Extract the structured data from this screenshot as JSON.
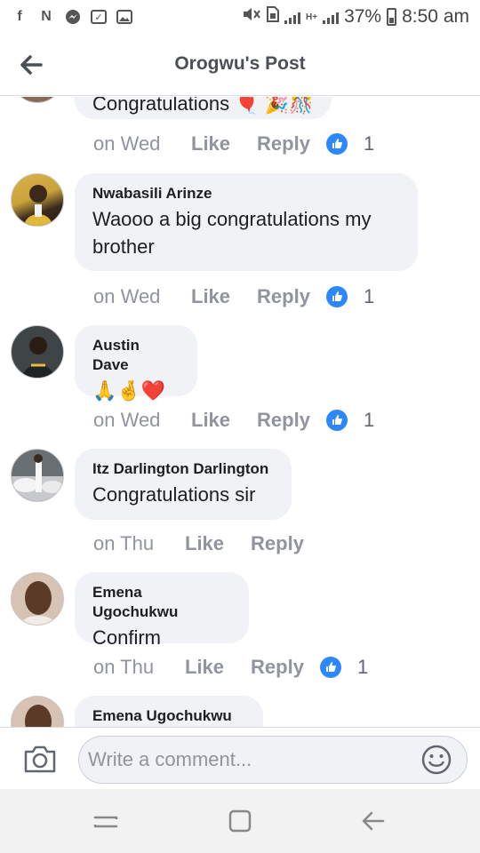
{
  "statusbar": {
    "battery": "37%",
    "time": "8:50 am",
    "network": "H+"
  },
  "header": {
    "title": "Orogwu's Post"
  },
  "comments": [
    {
      "author": "",
      "text": "Congratulations 🎈 🎉🎊",
      "time": "on Wed",
      "like": "Like",
      "reply": "Reply",
      "reactions": "1"
    },
    {
      "author": "Nwabasili Arinze",
      "text": "Waooo a big congratulations my brother",
      "time": "on Wed",
      "like": "Like",
      "reply": "Reply",
      "reactions": "1"
    },
    {
      "author": "Austin Dave",
      "text": "🙏🤞❤️",
      "time": "on Wed",
      "like": "Like",
      "reply": "Reply",
      "reactions": "1"
    },
    {
      "author": "Itz Darlington Darlington",
      "text": "Congratulations sir",
      "time": "on Thu",
      "like": "Like",
      "reply": "Reply",
      "reactions": ""
    },
    {
      "author": "Emena Ugochukwu",
      "text": "Confirm",
      "time": "on Thu",
      "like": "Like",
      "reply": "Reply",
      "reactions": "1"
    },
    {
      "author": "Emena Ugochukwu",
      "text": "",
      "time": "",
      "like": "",
      "reply": "",
      "reactions": ""
    }
  ],
  "composer": {
    "placeholder": "Write a comment..."
  },
  "icons": {
    "back": "arrow-left-icon",
    "camera": "camera-icon",
    "emoji": "smiley-icon",
    "reaction": "like-thumb-icon",
    "recents": "recent-apps-icon",
    "home": "home-icon",
    "navback": "back-icon"
  },
  "colors": {
    "reaction_blue": "#2d88ff",
    "bubble_bg": "#f0f2f5",
    "meta_gray": "#90949c"
  }
}
